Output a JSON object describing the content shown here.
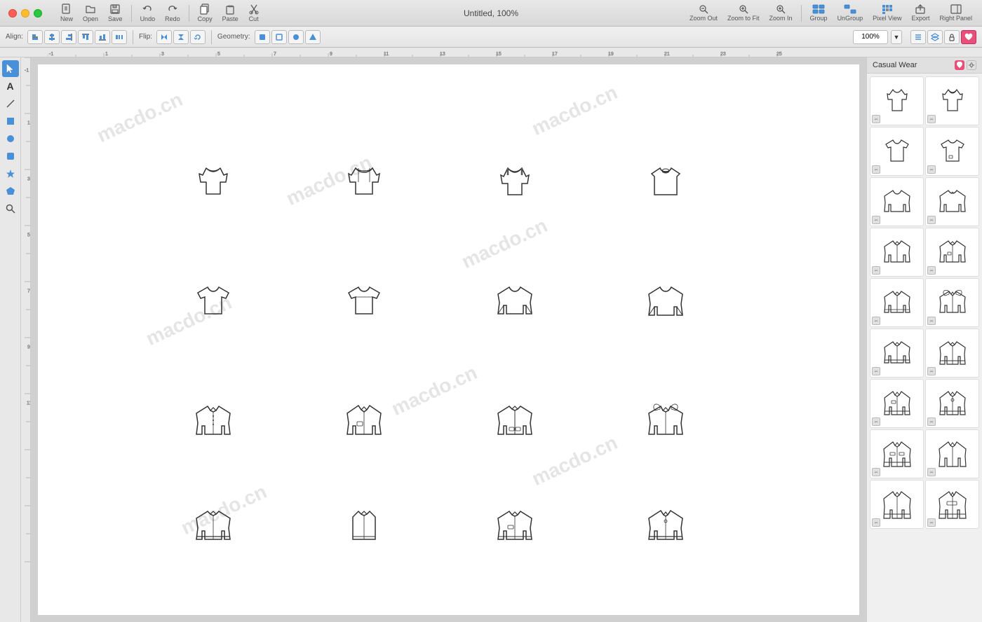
{
  "titlebar": {
    "title": "Untitled, 100%",
    "traffic": [
      "close",
      "minimize",
      "maximize"
    ]
  },
  "toolbar": {
    "file_buttons": [
      "New",
      "Open",
      "Save"
    ],
    "edit_buttons": [
      "Undo",
      "Redo"
    ],
    "clipboard_buttons": [
      "Copy",
      "Paste",
      "Cut"
    ],
    "view_buttons": [
      "Zoom Out",
      "Zoom to Fit",
      "Zoom In"
    ],
    "right_buttons": [
      "Group",
      "UnGroup",
      "Pixel View",
      "Export",
      "Right Panel"
    ],
    "align_label": "Align:",
    "flip_label": "Flip:",
    "geometry_label": "Geometry:",
    "zoom_value": "100%"
  },
  "right_panel": {
    "title": "Casual Wear",
    "items": [
      {
        "id": "rp1",
        "type": "tank-top-back"
      },
      {
        "id": "rp2",
        "type": "tank-top-front"
      },
      {
        "id": "rp3",
        "type": "tshirt-back"
      },
      {
        "id": "rp4",
        "type": "tshirt-front-polo"
      },
      {
        "id": "rp5",
        "type": "tshirt-plain"
      },
      {
        "id": "rp6",
        "type": "tshirt-collar"
      },
      {
        "id": "rp7",
        "type": "longsleeve1"
      },
      {
        "id": "rp8",
        "type": "longsleeve2"
      },
      {
        "id": "rp9",
        "type": "jacket1"
      },
      {
        "id": "rp10",
        "type": "jacket2"
      },
      {
        "id": "rp11",
        "type": "jacket3"
      },
      {
        "id": "rp12",
        "type": "jacket4"
      },
      {
        "id": "rp13",
        "type": "jacket5"
      },
      {
        "id": "rp14",
        "type": "jacket6"
      },
      {
        "id": "rp15",
        "type": "jacket7"
      },
      {
        "id": "rp16",
        "type": "jacket8"
      },
      {
        "id": "rp17",
        "type": "coat1"
      },
      {
        "id": "rp18",
        "type": "coat2"
      },
      {
        "id": "rp19",
        "type": "coat3"
      },
      {
        "id": "rp20",
        "type": "coat4"
      }
    ]
  },
  "canvas": {
    "watermarks": [
      "macdo.cn"
    ],
    "rows": [
      [
        "vest-simple",
        "vest-open",
        "vest-dark",
        "tshirt-round"
      ],
      [
        "tshirt-short1",
        "tshirt-short2",
        "sweatshirt1",
        "sweatshirt2"
      ],
      [
        "shirt-collar1",
        "shirt-pocket",
        "jacket-zip1",
        "jacket-hood"
      ],
      [
        "jacket-stripe",
        "vest-zipper",
        "jacket-bomber",
        "jacket-zip2"
      ]
    ]
  }
}
